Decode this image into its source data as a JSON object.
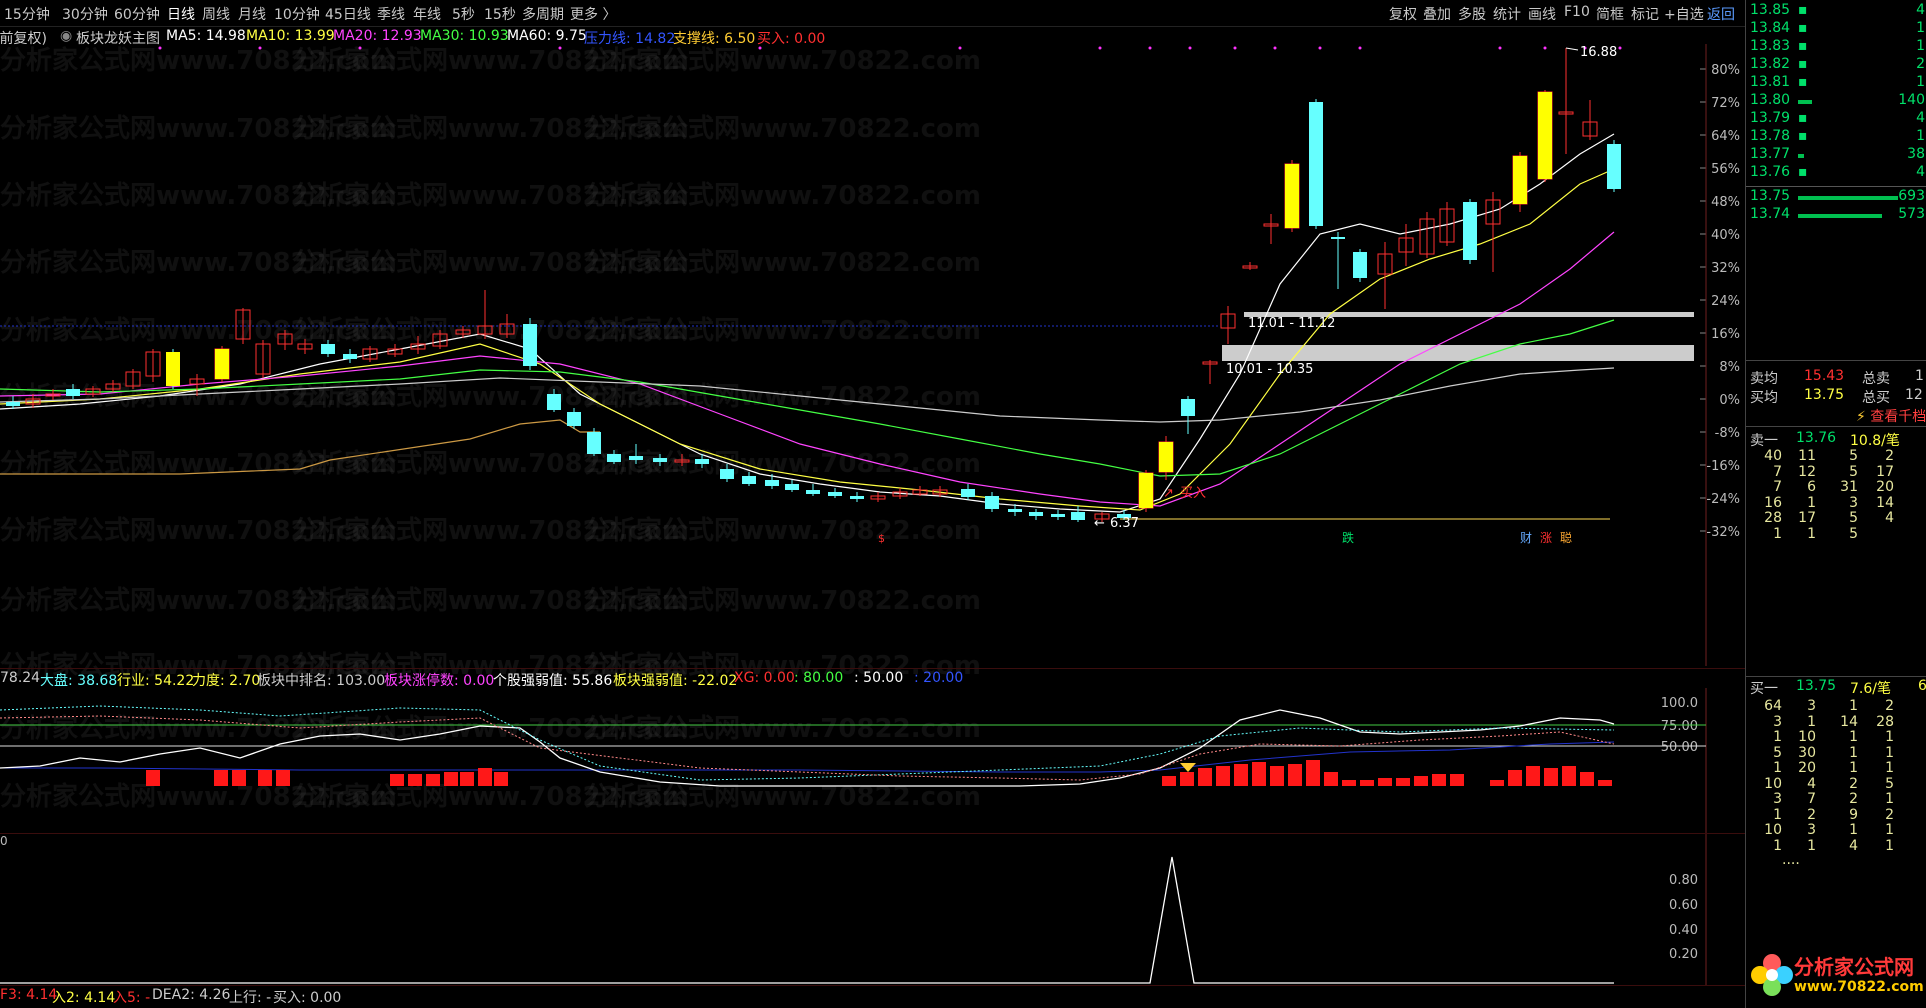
{
  "periods": [
    "15分钟",
    "30分钟",
    "60分钟",
    "日线",
    "周线",
    "月线",
    "10分钟",
    "45日线",
    "季线",
    "年线",
    "5秒",
    "15秒",
    "多周期",
    "更多 〉"
  ],
  "active_period": "日线",
  "tools": [
    "复权",
    "叠加",
    "多股",
    "统计",
    "画线",
    "F10",
    "简框",
    "标记",
    "+自选",
    "返回"
  ],
  "ma_line": {
    "prefix": "(前复权)",
    "title": "板块龙妖主图",
    "ma5": "MA5: 14.98",
    "ma10": "MA10: 13.99",
    "ma20": "MA20: 12.93",
    "ma30": "MA30: 10.93",
    "ma60": "MA60: 9.75",
    "pressure": "压力线: 14.82",
    "support": "支撑线: 6.50",
    "buy": "买入: 0.00"
  },
  "colors": {
    "ma5": "#ffffff",
    "ma10": "#ffff00",
    "ma20": "#ff44ff",
    "ma30": "#44ff44",
    "ma60": "#ffffff",
    "up": "#ffff00",
    "down": "#66ffff",
    "red": "#ff2020",
    "green": "#00e06a"
  },
  "main_axis": [
    "80%",
    "72%",
    "64%",
    "56%",
    "48%",
    "40%",
    "32%",
    "24%",
    "16%",
    "8%",
    "0%",
    "-8%",
    "-16%",
    "-24%",
    "-32%"
  ],
  "annotations": {
    "high": "16.88",
    "low": "6.37",
    "zone_upper": "11.01 - 11.12",
    "zone_lower": "10.01 - 10.35",
    "buy_signal": "买入",
    "markers": [
      "$",
      "跌",
      "财",
      "涨",
      "聪"
    ]
  },
  "indicator_line": {
    "v1": "78.24",
    "dapan": "大盘: 38.68",
    "hangye": "行业: 54.22",
    "lidu": "力度: 2.70",
    "rank": "板块中排名: 103.00",
    "zt": "板块涨停数: 0.00",
    "gq": "个股强弱值: 55.86",
    "bq": "板块强弱值: -22.02",
    "xg": "XG: 0.00",
    "c80": ": 80.00",
    "c50": ": 50.00",
    "c20": ": 20.00"
  },
  "mid_axis": [
    "100.0",
    "75.00",
    "50.00"
  ],
  "low_axis": [
    "0.80",
    "0.60",
    "0.40",
    "0.20"
  ],
  "low_label_zero": "0",
  "bottom_line": {
    "f3": "F3: 4.14",
    "r2": "入2: 4.14",
    "r5": "入5: -",
    "dea2": "DEA2: 4.26",
    "sx": "上行: -",
    "mr": "买入: 0.00"
  },
  "orderbook_asks": [
    {
      "price": "13.85",
      "vol": "4",
      "bar": 0
    },
    {
      "price": "13.84",
      "vol": "1",
      "bar": 0
    },
    {
      "price": "13.83",
      "vol": "1",
      "bar": 0
    },
    {
      "price": "13.82",
      "vol": "2",
      "bar": 0
    },
    {
      "price": "13.81",
      "vol": "1",
      "bar": 0
    },
    {
      "price": "13.80",
      "vol": "140",
      "bar": 14
    },
    {
      "price": "13.79",
      "vol": "4",
      "bar": 0
    },
    {
      "price": "13.78",
      "vol": "1",
      "bar": 0
    },
    {
      "price": "13.77",
      "vol": "38",
      "bar": 6
    },
    {
      "price": "13.76",
      "vol": "4",
      "bar": 0
    }
  ],
  "orderbook_bids": [
    {
      "price": "13.75",
      "vol": "693",
      "bar": 100
    },
    {
      "price": "13.74",
      "vol": "573",
      "bar": 84
    }
  ],
  "summary": {
    "row1": [
      "卖均",
      "15.43",
      "总卖",
      "1"
    ],
    "row2": [
      "买均",
      "13.75",
      "总买",
      "12"
    ],
    "link": "查看千档"
  },
  "sell_one": {
    "label": "卖一",
    "price": "13.76",
    "vol": "10.8/笔"
  },
  "sell_grid": [
    [
      "40",
      "11",
      "5",
      "2"
    ],
    [
      "7",
      "12",
      "5",
      "17"
    ],
    [
      "7",
      "6",
      "31",
      "20"
    ],
    [
      "16",
      "1",
      "3",
      "14"
    ],
    [
      "28",
      "17",
      "5",
      "4"
    ],
    [
      "1",
      "1",
      "5",
      ""
    ]
  ],
  "buy_one": {
    "label": "买一",
    "price": "13.75",
    "vol": "7.6/笔",
    "tail": "6"
  },
  "buy_grid": [
    [
      "64",
      "3",
      "1",
      "2"
    ],
    [
      "3",
      "1",
      "14",
      "28"
    ],
    [
      "1",
      "10",
      "1",
      "1"
    ],
    [
      "5",
      "30",
      "1",
      "1"
    ],
    [
      "1",
      "20",
      "1",
      "1"
    ],
    [
      "10",
      "4",
      "2",
      "5"
    ],
    [
      "3",
      "7",
      "2",
      "1"
    ],
    [
      "1",
      "2",
      "9",
      "2"
    ],
    [
      "10",
      "3",
      "1",
      "1"
    ],
    [
      "1",
      "1",
      "4",
      "1"
    ]
  ],
  "ellipsis": "....",
  "logo": {
    "text": "分析家公式网",
    "url": "www.70822.com"
  },
  "watermark": "分析家公式网www.70822.com"
}
